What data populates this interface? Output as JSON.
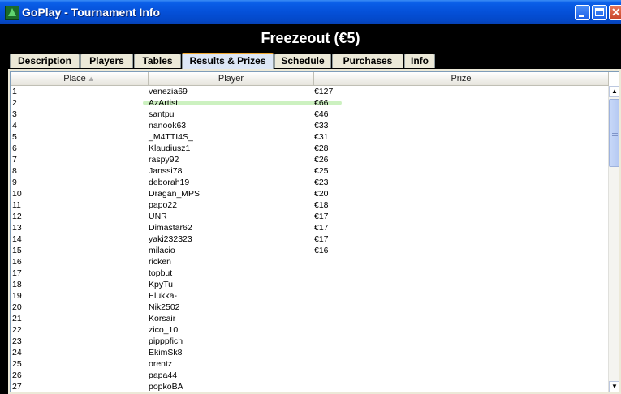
{
  "window": {
    "title": "GoPlay - Tournament Info"
  },
  "header": {
    "title": "Freezeout (€5)"
  },
  "tabs": [
    {
      "label": "Description",
      "active": false
    },
    {
      "label": "Players",
      "active": false
    },
    {
      "label": "Tables",
      "active": false
    },
    {
      "label": "Results & Prizes",
      "active": true
    },
    {
      "label": "Schedule",
      "active": false
    },
    {
      "label": "Purchases",
      "active": false
    },
    {
      "label": "Info",
      "active": false
    }
  ],
  "table": {
    "columns": [
      "Place",
      "Player",
      "Prize"
    ],
    "sort_icon": "sort-ascending-icon",
    "rows": [
      {
        "place": "1",
        "player": "venezia69",
        "prize": "€127"
      },
      {
        "place": "2",
        "player": "AzArtist",
        "prize": "€66"
      },
      {
        "place": "3",
        "player": "santpu",
        "prize": "€46"
      },
      {
        "place": "4",
        "player": "nanook63",
        "prize": "€33"
      },
      {
        "place": "5",
        "player": "_M4TTI4S_",
        "prize": "€31"
      },
      {
        "place": "6",
        "player": "Klaudiusz1",
        "prize": "€28"
      },
      {
        "place": "7",
        "player": "raspy92",
        "prize": "€26"
      },
      {
        "place": "8",
        "player": "Janssi78",
        "prize": "€25"
      },
      {
        "place": "9",
        "player": "deborah19",
        "prize": "€23"
      },
      {
        "place": "10",
        "player": "Dragan_MPS",
        "prize": "€20"
      },
      {
        "place": "11",
        "player": "papo22",
        "prize": "€18"
      },
      {
        "place": "12",
        "player": "UNR",
        "prize": "€17"
      },
      {
        "place": "13",
        "player": "Dimastar62",
        "prize": "€17"
      },
      {
        "place": "14",
        "player": "yaki232323",
        "prize": "€17"
      },
      {
        "place": "15",
        "player": "milacio",
        "prize": "€16"
      },
      {
        "place": "16",
        "player": "ricken",
        "prize": ""
      },
      {
        "place": "17",
        "player": "topbut",
        "prize": ""
      },
      {
        "place": "18",
        "player": "KpyTu",
        "prize": ""
      },
      {
        "place": "19",
        "player": "Elukka-",
        "prize": ""
      },
      {
        "place": "20",
        "player": "Nik2502",
        "prize": ""
      },
      {
        "place": "21",
        "player": "Korsair",
        "prize": ""
      },
      {
        "place": "22",
        "player": "zico_10",
        "prize": ""
      },
      {
        "place": "23",
        "player": "pipppfich",
        "prize": ""
      },
      {
        "place": "24",
        "player": "EkimSk8",
        "prize": ""
      },
      {
        "place": "25",
        "player": "orentz",
        "prize": ""
      },
      {
        "place": "26",
        "player": "papa44",
        "prize": ""
      },
      {
        "place": "27",
        "player": "popkoBA",
        "prize": ""
      }
    ]
  },
  "colors": {
    "titlebar": "#0550d8",
    "header_bg": "#000000",
    "highlight": "#bfeeb0",
    "active_tab_accent": "#f0a830"
  }
}
